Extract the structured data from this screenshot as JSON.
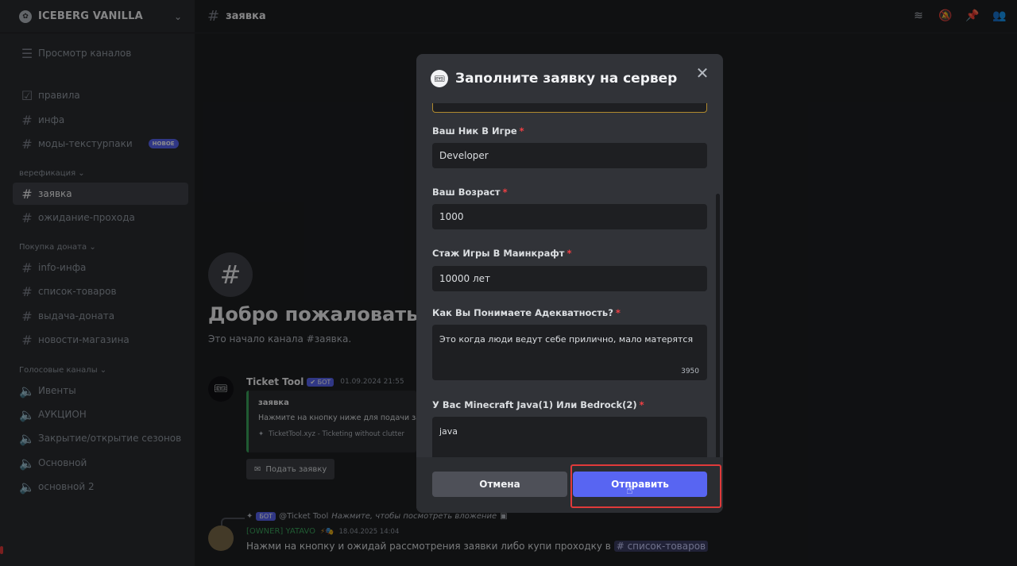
{
  "server": {
    "name": "ICEBERG VANILLA"
  },
  "sidebar": {
    "browse_label": "Просмотр каналов",
    "new_badge": "НОВОЕ",
    "channels_top": [
      {
        "label": "правила",
        "icon": "rules-icon"
      },
      {
        "label": "инфа",
        "icon": "hash-icon"
      },
      {
        "label": "моды-текстурпаки",
        "icon": "hash-icon"
      }
    ],
    "cat_verification": "верефикация",
    "channels_verification": [
      {
        "label": "заявка",
        "icon": "hash-icon"
      },
      {
        "label": "ожидание-прохода",
        "icon": "hash-icon"
      }
    ],
    "cat_donate": "Покупка доната",
    "channels_donate": [
      {
        "label": "info-инфа",
        "icon": "hash-icon"
      },
      {
        "label": "список-товаров",
        "icon": "hash-icon"
      },
      {
        "label": "выдача-доната",
        "icon": "hash-icon"
      },
      {
        "label": "новости-магазина",
        "icon": "hash-icon"
      }
    ],
    "cat_voice": "Голосовые каналы",
    "channels_voice": [
      {
        "label": "Ивенты",
        "icon": "speaker-icon"
      },
      {
        "label": "АУКЦИОН",
        "icon": "speaker-icon"
      },
      {
        "label": "Закрытие/открытие сезонов",
        "icon": "speaker-icon"
      },
      {
        "label": "Основной",
        "icon": "speaker-icon"
      },
      {
        "label": "основной 2",
        "icon": "speaker-icon"
      }
    ]
  },
  "topbar": {
    "channel": "заявка"
  },
  "chat": {
    "welcome_title": "Добро пожаловать на",
    "welcome_sub": "Это начало канала #заявка.",
    "msg1": {
      "author": "Ticket Tool",
      "bot_tag": "✔ БОТ",
      "timestamp": "01.09.2024 21:55",
      "embed_title": "заявка",
      "embed_desc": "Нажмите на кнопку ниже для подачи заявки",
      "embed_footer": "TicketTool.xyz - Ticketing without clutter",
      "button": "Подать заявку"
    },
    "msg2": {
      "reply_bot_tag": "БОТ",
      "reply_author": "@Ticket Tool",
      "reply_text": "Нажмите, чтобы посмотреть вложение",
      "author": "[OWNER] YATAVO",
      "timestamp": "18.04.2025 14:04",
      "text": "Нажми на кнопку и ожидай рассмотрения заявки либо купи проходку в",
      "mention": "# список-товаров"
    }
  },
  "modal": {
    "title": "Заполните заявку на сервер",
    "fields": [
      {
        "label": "Ваш Ник В Игре",
        "value": "Developer"
      },
      {
        "label": "Ваш Возраст",
        "value": "1000"
      },
      {
        "label": "Стаж Игры В Маинкрафт",
        "value": "10000 лет"
      },
      {
        "label": "Как Вы Понимаете Адекватность?",
        "value": "Это когда люди ведут себе прилично, мало матерятся",
        "counter": "3950"
      },
      {
        "label": "У Вас Minecraft Java(1) Или Bedrock(2)",
        "value": "java"
      }
    ],
    "cancel": "Отмена",
    "submit": "Отправить"
  },
  "colors": {
    "accent": "#5865f2",
    "highlight": "#e03a3a",
    "required": "#f23f43"
  }
}
